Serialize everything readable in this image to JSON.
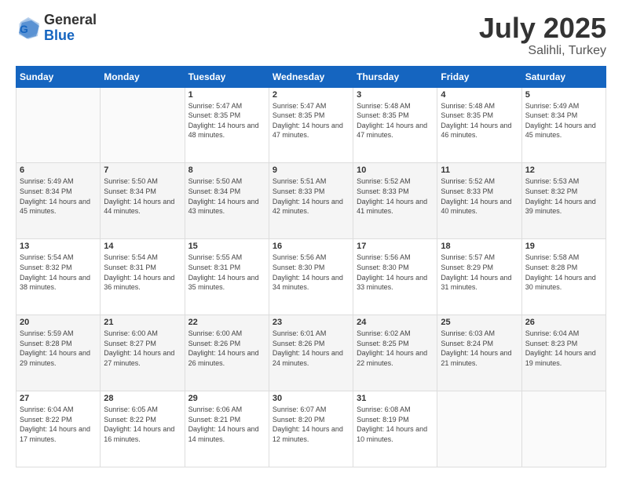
{
  "header": {
    "logo_general": "General",
    "logo_blue": "Blue",
    "month_title": "July 2025",
    "location": "Salihli, Turkey"
  },
  "days_of_week": [
    "Sunday",
    "Monday",
    "Tuesday",
    "Wednesday",
    "Thursday",
    "Friday",
    "Saturday"
  ],
  "weeks": [
    [
      {
        "day": "",
        "sunrise": "",
        "sunset": "",
        "daylight": ""
      },
      {
        "day": "",
        "sunrise": "",
        "sunset": "",
        "daylight": ""
      },
      {
        "day": "1",
        "sunrise": "Sunrise: 5:47 AM",
        "sunset": "Sunset: 8:35 PM",
        "daylight": "Daylight: 14 hours and 48 minutes."
      },
      {
        "day": "2",
        "sunrise": "Sunrise: 5:47 AM",
        "sunset": "Sunset: 8:35 PM",
        "daylight": "Daylight: 14 hours and 47 minutes."
      },
      {
        "day": "3",
        "sunrise": "Sunrise: 5:48 AM",
        "sunset": "Sunset: 8:35 PM",
        "daylight": "Daylight: 14 hours and 47 minutes."
      },
      {
        "day": "4",
        "sunrise": "Sunrise: 5:48 AM",
        "sunset": "Sunset: 8:35 PM",
        "daylight": "Daylight: 14 hours and 46 minutes."
      },
      {
        "day": "5",
        "sunrise": "Sunrise: 5:49 AM",
        "sunset": "Sunset: 8:34 PM",
        "daylight": "Daylight: 14 hours and 45 minutes."
      }
    ],
    [
      {
        "day": "6",
        "sunrise": "Sunrise: 5:49 AM",
        "sunset": "Sunset: 8:34 PM",
        "daylight": "Daylight: 14 hours and 45 minutes."
      },
      {
        "day": "7",
        "sunrise": "Sunrise: 5:50 AM",
        "sunset": "Sunset: 8:34 PM",
        "daylight": "Daylight: 14 hours and 44 minutes."
      },
      {
        "day": "8",
        "sunrise": "Sunrise: 5:50 AM",
        "sunset": "Sunset: 8:34 PM",
        "daylight": "Daylight: 14 hours and 43 minutes."
      },
      {
        "day": "9",
        "sunrise": "Sunrise: 5:51 AM",
        "sunset": "Sunset: 8:33 PM",
        "daylight": "Daylight: 14 hours and 42 minutes."
      },
      {
        "day": "10",
        "sunrise": "Sunrise: 5:52 AM",
        "sunset": "Sunset: 8:33 PM",
        "daylight": "Daylight: 14 hours and 41 minutes."
      },
      {
        "day": "11",
        "sunrise": "Sunrise: 5:52 AM",
        "sunset": "Sunset: 8:33 PM",
        "daylight": "Daylight: 14 hours and 40 minutes."
      },
      {
        "day": "12",
        "sunrise": "Sunrise: 5:53 AM",
        "sunset": "Sunset: 8:32 PM",
        "daylight": "Daylight: 14 hours and 39 minutes."
      }
    ],
    [
      {
        "day": "13",
        "sunrise": "Sunrise: 5:54 AM",
        "sunset": "Sunset: 8:32 PM",
        "daylight": "Daylight: 14 hours and 38 minutes."
      },
      {
        "day": "14",
        "sunrise": "Sunrise: 5:54 AM",
        "sunset": "Sunset: 8:31 PM",
        "daylight": "Daylight: 14 hours and 36 minutes."
      },
      {
        "day": "15",
        "sunrise": "Sunrise: 5:55 AM",
        "sunset": "Sunset: 8:31 PM",
        "daylight": "Daylight: 14 hours and 35 minutes."
      },
      {
        "day": "16",
        "sunrise": "Sunrise: 5:56 AM",
        "sunset": "Sunset: 8:30 PM",
        "daylight": "Daylight: 14 hours and 34 minutes."
      },
      {
        "day": "17",
        "sunrise": "Sunrise: 5:56 AM",
        "sunset": "Sunset: 8:30 PM",
        "daylight": "Daylight: 14 hours and 33 minutes."
      },
      {
        "day": "18",
        "sunrise": "Sunrise: 5:57 AM",
        "sunset": "Sunset: 8:29 PM",
        "daylight": "Daylight: 14 hours and 31 minutes."
      },
      {
        "day": "19",
        "sunrise": "Sunrise: 5:58 AM",
        "sunset": "Sunset: 8:28 PM",
        "daylight": "Daylight: 14 hours and 30 minutes."
      }
    ],
    [
      {
        "day": "20",
        "sunrise": "Sunrise: 5:59 AM",
        "sunset": "Sunset: 8:28 PM",
        "daylight": "Daylight: 14 hours and 29 minutes."
      },
      {
        "day": "21",
        "sunrise": "Sunrise: 6:00 AM",
        "sunset": "Sunset: 8:27 PM",
        "daylight": "Daylight: 14 hours and 27 minutes."
      },
      {
        "day": "22",
        "sunrise": "Sunrise: 6:00 AM",
        "sunset": "Sunset: 8:26 PM",
        "daylight": "Daylight: 14 hours and 26 minutes."
      },
      {
        "day": "23",
        "sunrise": "Sunrise: 6:01 AM",
        "sunset": "Sunset: 8:26 PM",
        "daylight": "Daylight: 14 hours and 24 minutes."
      },
      {
        "day": "24",
        "sunrise": "Sunrise: 6:02 AM",
        "sunset": "Sunset: 8:25 PM",
        "daylight": "Daylight: 14 hours and 22 minutes."
      },
      {
        "day": "25",
        "sunrise": "Sunrise: 6:03 AM",
        "sunset": "Sunset: 8:24 PM",
        "daylight": "Daylight: 14 hours and 21 minutes."
      },
      {
        "day": "26",
        "sunrise": "Sunrise: 6:04 AM",
        "sunset": "Sunset: 8:23 PM",
        "daylight": "Daylight: 14 hours and 19 minutes."
      }
    ],
    [
      {
        "day": "27",
        "sunrise": "Sunrise: 6:04 AM",
        "sunset": "Sunset: 8:22 PM",
        "daylight": "Daylight: 14 hours and 17 minutes."
      },
      {
        "day": "28",
        "sunrise": "Sunrise: 6:05 AM",
        "sunset": "Sunset: 8:22 PM",
        "daylight": "Daylight: 14 hours and 16 minutes."
      },
      {
        "day": "29",
        "sunrise": "Sunrise: 6:06 AM",
        "sunset": "Sunset: 8:21 PM",
        "daylight": "Daylight: 14 hours and 14 minutes."
      },
      {
        "day": "30",
        "sunrise": "Sunrise: 6:07 AM",
        "sunset": "Sunset: 8:20 PM",
        "daylight": "Daylight: 14 hours and 12 minutes."
      },
      {
        "day": "31",
        "sunrise": "Sunrise: 6:08 AM",
        "sunset": "Sunset: 8:19 PM",
        "daylight": "Daylight: 14 hours and 10 minutes."
      },
      {
        "day": "",
        "sunrise": "",
        "sunset": "",
        "daylight": ""
      },
      {
        "day": "",
        "sunrise": "",
        "sunset": "",
        "daylight": ""
      }
    ]
  ]
}
